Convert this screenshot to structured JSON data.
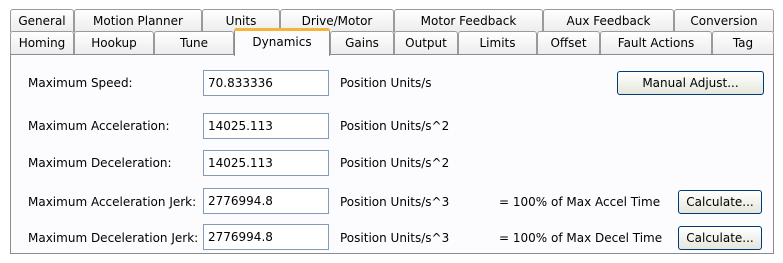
{
  "tabs_row1": [
    "General",
    "Motion Planner",
    "Units",
    "Drive/Motor",
    "Motor Feedback",
    "Aux Feedback",
    "Conversion"
  ],
  "tabs_row2": [
    "Homing",
    "Hookup",
    "Tune",
    "Dynamics",
    "Gains",
    "Output",
    "Limits",
    "Offset",
    "Fault Actions",
    "Tag"
  ],
  "active_tab": "Dynamics",
  "dynamics": {
    "max_speed": {
      "label": "Maximum Speed:",
      "value": "70.833336",
      "unit": "Position Units/s"
    },
    "max_accel": {
      "label": "Maximum Acceleration:",
      "value": "14025.113",
      "unit": "Position Units/s^2"
    },
    "max_decel": {
      "label": "Maximum Deceleration:",
      "value": "14025.113",
      "unit": "Position Units/s^2"
    },
    "max_accel_jerk": {
      "label": "Maximum Acceleration Jerk:",
      "value": "2776994.8",
      "unit": "Position Units/s^3",
      "note": "= 100% of Max Accel Time"
    },
    "max_decel_jerk": {
      "label": "Maximum Deceleration Jerk:",
      "value": "2776994.8",
      "unit": "Position Units/s^3",
      "note": "= 100% of Max Decel Time"
    }
  },
  "buttons": {
    "manual_adjust": "Manual Adjust...",
    "calculate": "Calculate..."
  }
}
